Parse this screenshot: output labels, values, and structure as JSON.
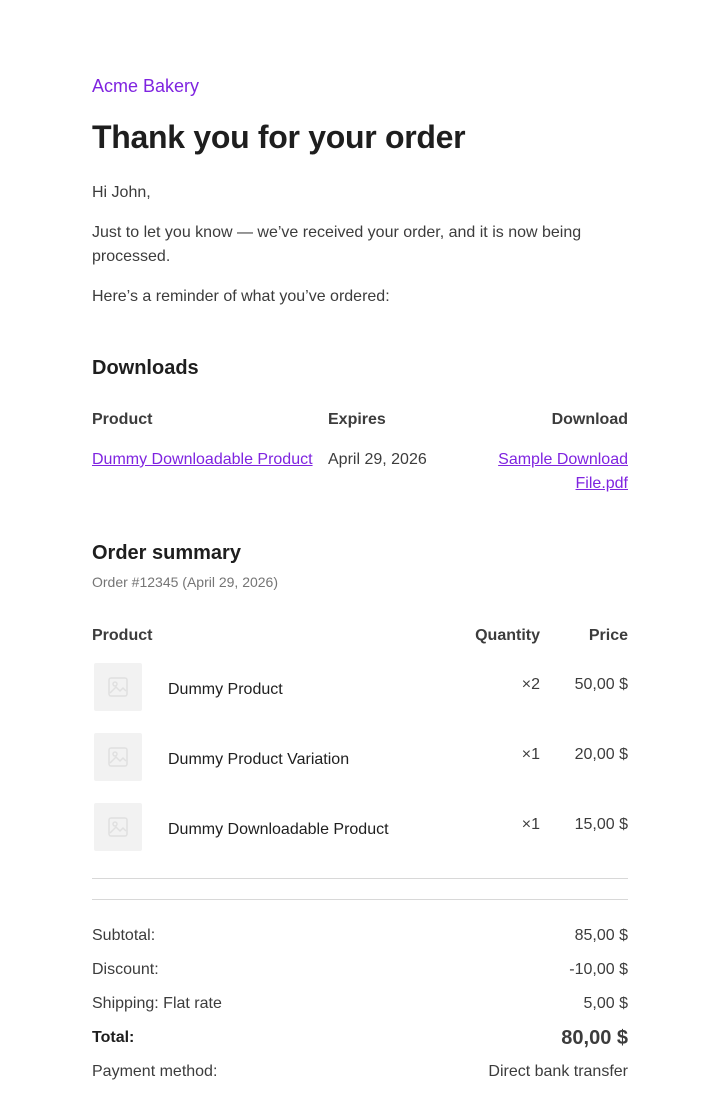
{
  "store": {
    "name": "Acme Bakery"
  },
  "heading": "Thank you for your order",
  "greeting": "Hi John,",
  "intro": "Just to let you know — we’ve received your order, and it is now being processed.",
  "reminder": "Here’s a reminder of what you’ve ordered:",
  "downloads": {
    "title": "Downloads",
    "headers": {
      "product": "Product",
      "expires": "Expires",
      "download": "Download"
    },
    "rows": [
      {
        "product": "Dummy Downloadable Product",
        "expires": "April 29, 2026",
        "file": "Sample Download File.pdf"
      }
    ]
  },
  "order_summary": {
    "title": "Order summary",
    "order_number": "Order #12345 (April 29, 2026)",
    "headers": {
      "product": "Product",
      "quantity": "Quantity",
      "price": "Price"
    },
    "items": [
      {
        "name": "Dummy Product",
        "quantity": "×2",
        "price": "50,00 $",
        "thumb_icon": "image-placeholder-icon"
      },
      {
        "name": "Dummy Product Variation",
        "quantity": "×1",
        "price": "20,00 $",
        "thumb_icon": "image-placeholder-icon"
      },
      {
        "name": "Dummy Downloadable Product",
        "quantity": "×1",
        "price": "15,00 $",
        "thumb_icon": "image-placeholder-icon"
      }
    ]
  },
  "totals": {
    "subtotal_label": "Subtotal:",
    "subtotal": "85,00 $",
    "discount_label": "Discount:",
    "discount": "-10,00 $",
    "shipping_label": "Shipping: Flat rate",
    "shipping": "5,00 $",
    "total_label": "Total:",
    "total": "80,00 $",
    "payment_label": "Payment method:",
    "payment": "Direct bank transfer"
  },
  "colors": {
    "accent": "#7f24e0",
    "heading": "#1e1e1e",
    "text": "#3c3c3c",
    "muted": "#757575",
    "divider": "#d8d8d8"
  }
}
